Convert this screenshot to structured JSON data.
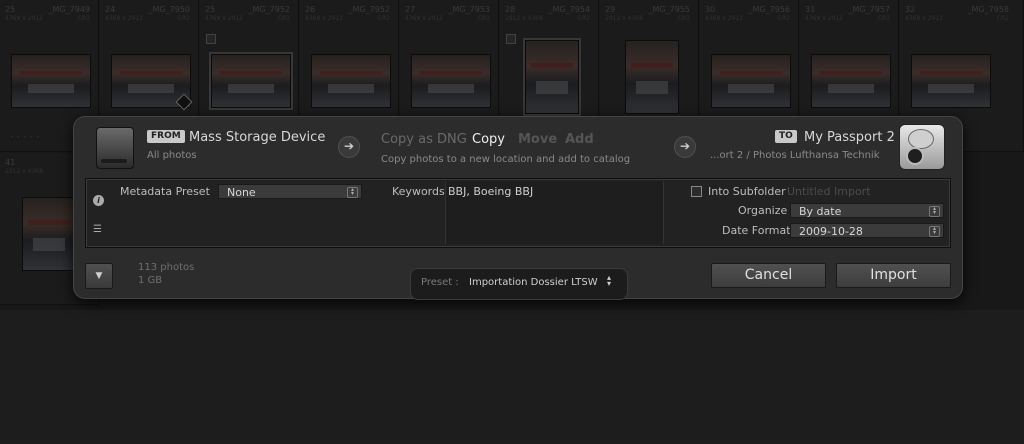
{
  "grid": {
    "cells": [
      {
        "num": "25",
        "fname": "_MG_7949",
        "dims": "4368 x 2912",
        "ext": "CR2"
      },
      {
        "num": "24",
        "fname": "_MG_7950",
        "dims": "4368 x 2912",
        "ext": "CR2"
      },
      {
        "num": "25",
        "fname": "_MG_7952",
        "dims": "4368 x 2912",
        "ext": "CR2"
      },
      {
        "num": "26",
        "fname": "_MG_7952",
        "dims": "4368 x 2912",
        "ext": "CR2"
      },
      {
        "num": "27",
        "fname": "_MG_7953",
        "dims": "4368 x 2912",
        "ext": "CR2"
      },
      {
        "num": "28",
        "fname": "_MG_7954",
        "dims": "2912 x 4368",
        "ext": "CR2"
      },
      {
        "num": "29",
        "fname": "_MG_7955",
        "dims": "2912 x 4368",
        "ext": "CR2"
      },
      {
        "num": "30",
        "fname": "_MG_7956",
        "dims": "4368 x 2912",
        "ext": "CR2"
      },
      {
        "num": "31",
        "fname": "_MG_7957",
        "dims": "4368 x 2912",
        "ext": "CR2"
      },
      {
        "num": "32",
        "fname": "_MG_7958",
        "dims": "4368 x 2912",
        "ext": "CR2"
      },
      {
        "num": "41",
        "fname": "",
        "dims": "2912 x 4368",
        "ext": ""
      }
    ]
  },
  "source": {
    "tag": "FROM",
    "name": "Mass Storage Device",
    "sub": "All photos",
    "icon": "hard-drive-icon"
  },
  "modes": {
    "copy_dng": "Copy as DNG",
    "copy": "Copy",
    "move": "Move",
    "add": "Add",
    "description": "Copy photos to a new location and add to catalog"
  },
  "destination": {
    "tag": "TO",
    "name": "My Passport 2",
    "path": "...ort 2 / Photos Lufthansa Technik",
    "icon": "external-drive-icon"
  },
  "options": {
    "metadata_label": "Metadata Preset",
    "metadata_value": "None",
    "keywords_label": "Keywords",
    "keywords_value": "BBJ, Boeing BBJ",
    "subfolder_label": "Into Subfolder",
    "subfolder_placeholder": "Untitled Import",
    "organize_label": "Organize",
    "organize_value": "By date",
    "date_format_label": "Date Format",
    "date_format_value": "2009-10-28"
  },
  "summary": {
    "photos": "113 photos",
    "size": "1 GB"
  },
  "preset": {
    "label": "Preset :",
    "value": "Importation Dossier LTSW"
  },
  "buttons": {
    "cancel": "Cancel",
    "import": "Import"
  },
  "colors": {
    "dialog_bg": "#2c2c2c",
    "accent_text": "#d8d8d8",
    "muted_text": "#8a8a8a"
  }
}
